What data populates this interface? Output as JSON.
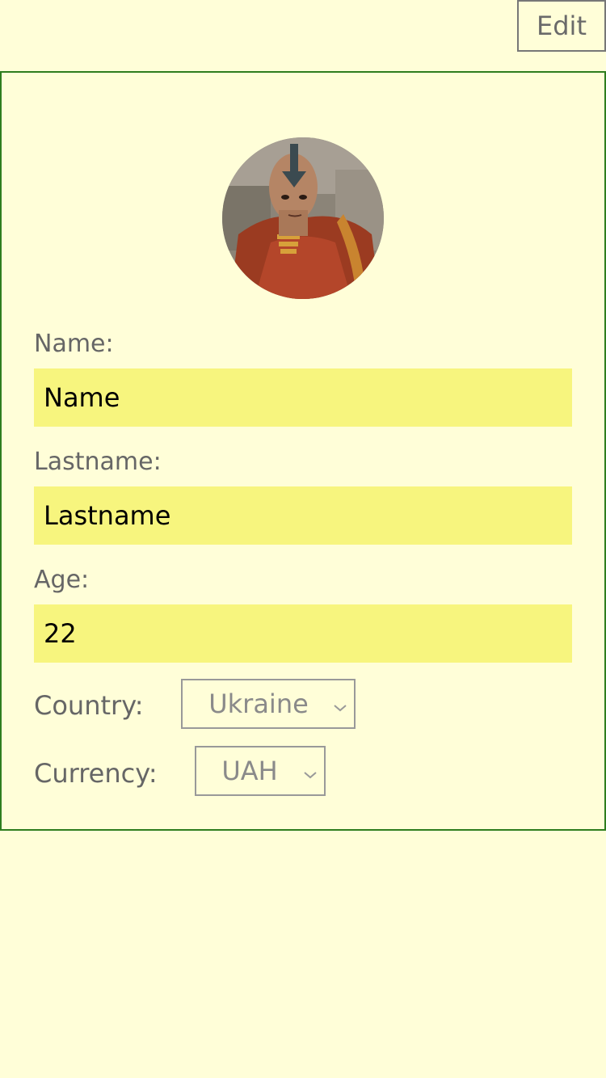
{
  "header": {
    "edit_label": "Edit"
  },
  "profile": {
    "avatar_alt": "profile photo",
    "name": {
      "label": "Name:",
      "value": "Name"
    },
    "lastname": {
      "label": "Lastname:",
      "value": "Lastname"
    },
    "age": {
      "label": "Age:",
      "value": "22"
    },
    "country": {
      "label": "Country:",
      "selected": "Ukraine"
    },
    "currency": {
      "label": "Currency:",
      "selected": "UAH"
    }
  },
  "colors": {
    "background": "#fffed8",
    "card_border": "#2e7d1e",
    "input_bg": "#f7f57e"
  }
}
